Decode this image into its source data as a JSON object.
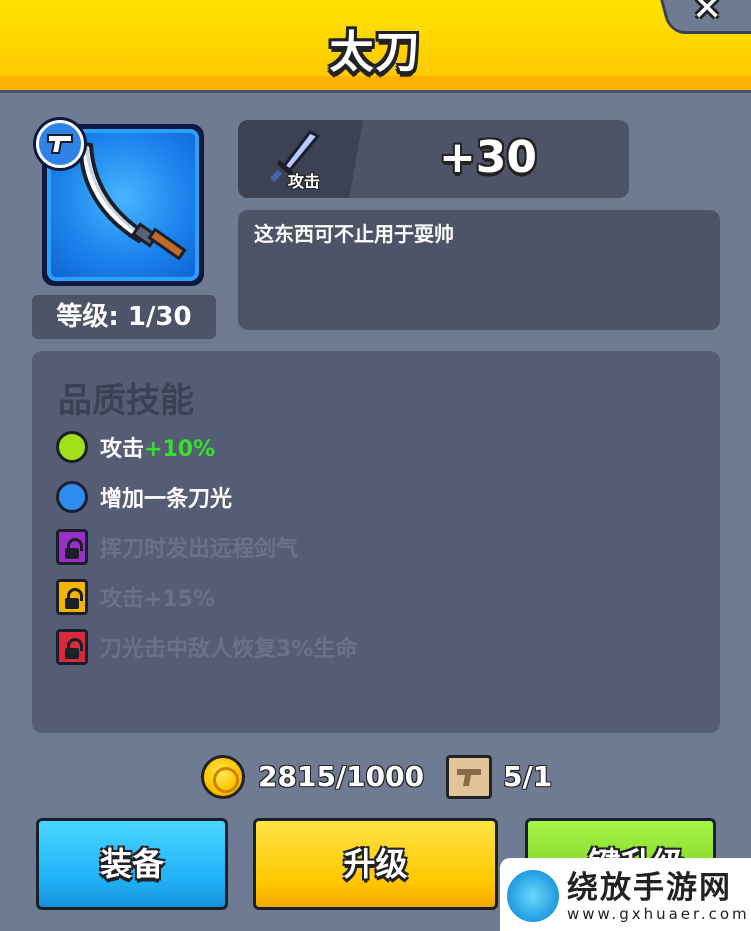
{
  "header": {
    "title": "太刀"
  },
  "item": {
    "level_label": "等级: 1/30",
    "icon": "katana-icon",
    "badge_icon": "pistol-icon"
  },
  "stat": {
    "label": "攻击",
    "value": "+30",
    "icon": "sword-icon"
  },
  "description": "这东西可不止用于耍帅",
  "skills": {
    "title": "品质技能",
    "items": [
      {
        "text": "攻击",
        "bonus": "+10%",
        "state": "unlocked",
        "color": "#a3e01c"
      },
      {
        "text": "增加一条刀光",
        "state": "unlocked",
        "color": "#2f8cf0"
      },
      {
        "text": "挥刀时发出远程剑气",
        "state": "locked",
        "color": "#9b2fc9"
      },
      {
        "text": "攻击+15%",
        "state": "locked",
        "color": "#f2b600"
      },
      {
        "text": "刀光击中敌人恢复3%生命",
        "state": "locked",
        "color": "#d72a3a"
      }
    ]
  },
  "resources": {
    "coins": "2815/1000",
    "coin_icon": "gold-coin-icon",
    "scrolls": "5/1",
    "scroll_icon": "blueprint-scroll-icon"
  },
  "buttons": {
    "equip": "装备",
    "upgrade": "升级",
    "one_click": "一键升级"
  },
  "watermark": {
    "title": "绕放手游网",
    "url": "www.gxhuaer.com"
  }
}
